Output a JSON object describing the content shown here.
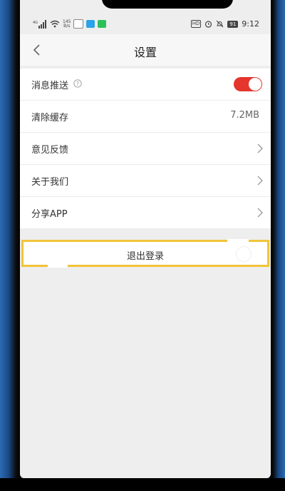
{
  "status_bar": {
    "network_type": "4G",
    "speed_value": "145",
    "speed_unit": "B/s",
    "hd_label": "HD",
    "battery": "91",
    "time": "9:12",
    "icons": [
      "signal-icon",
      "wifi-icon",
      "tencent-app-icon",
      "telegram-icon",
      "wechat-icon",
      "alarm-icon",
      "mute-icon"
    ]
  },
  "header": {
    "title": "设置",
    "back_icon": "chevron-left-icon"
  },
  "settings": {
    "items": [
      {
        "label": "消息推送",
        "type": "toggle",
        "toggle_on": true,
        "accent": "#e5352d"
      },
      {
        "label": "清除缓存",
        "type": "value",
        "value": "7.2MB"
      },
      {
        "label": "意见反馈",
        "type": "link"
      },
      {
        "label": "关于我们",
        "type": "link"
      },
      {
        "label": "分享APP",
        "type": "link"
      }
    ]
  },
  "logout": {
    "label": "退出登录",
    "highlight_color": "#f2c43a"
  }
}
